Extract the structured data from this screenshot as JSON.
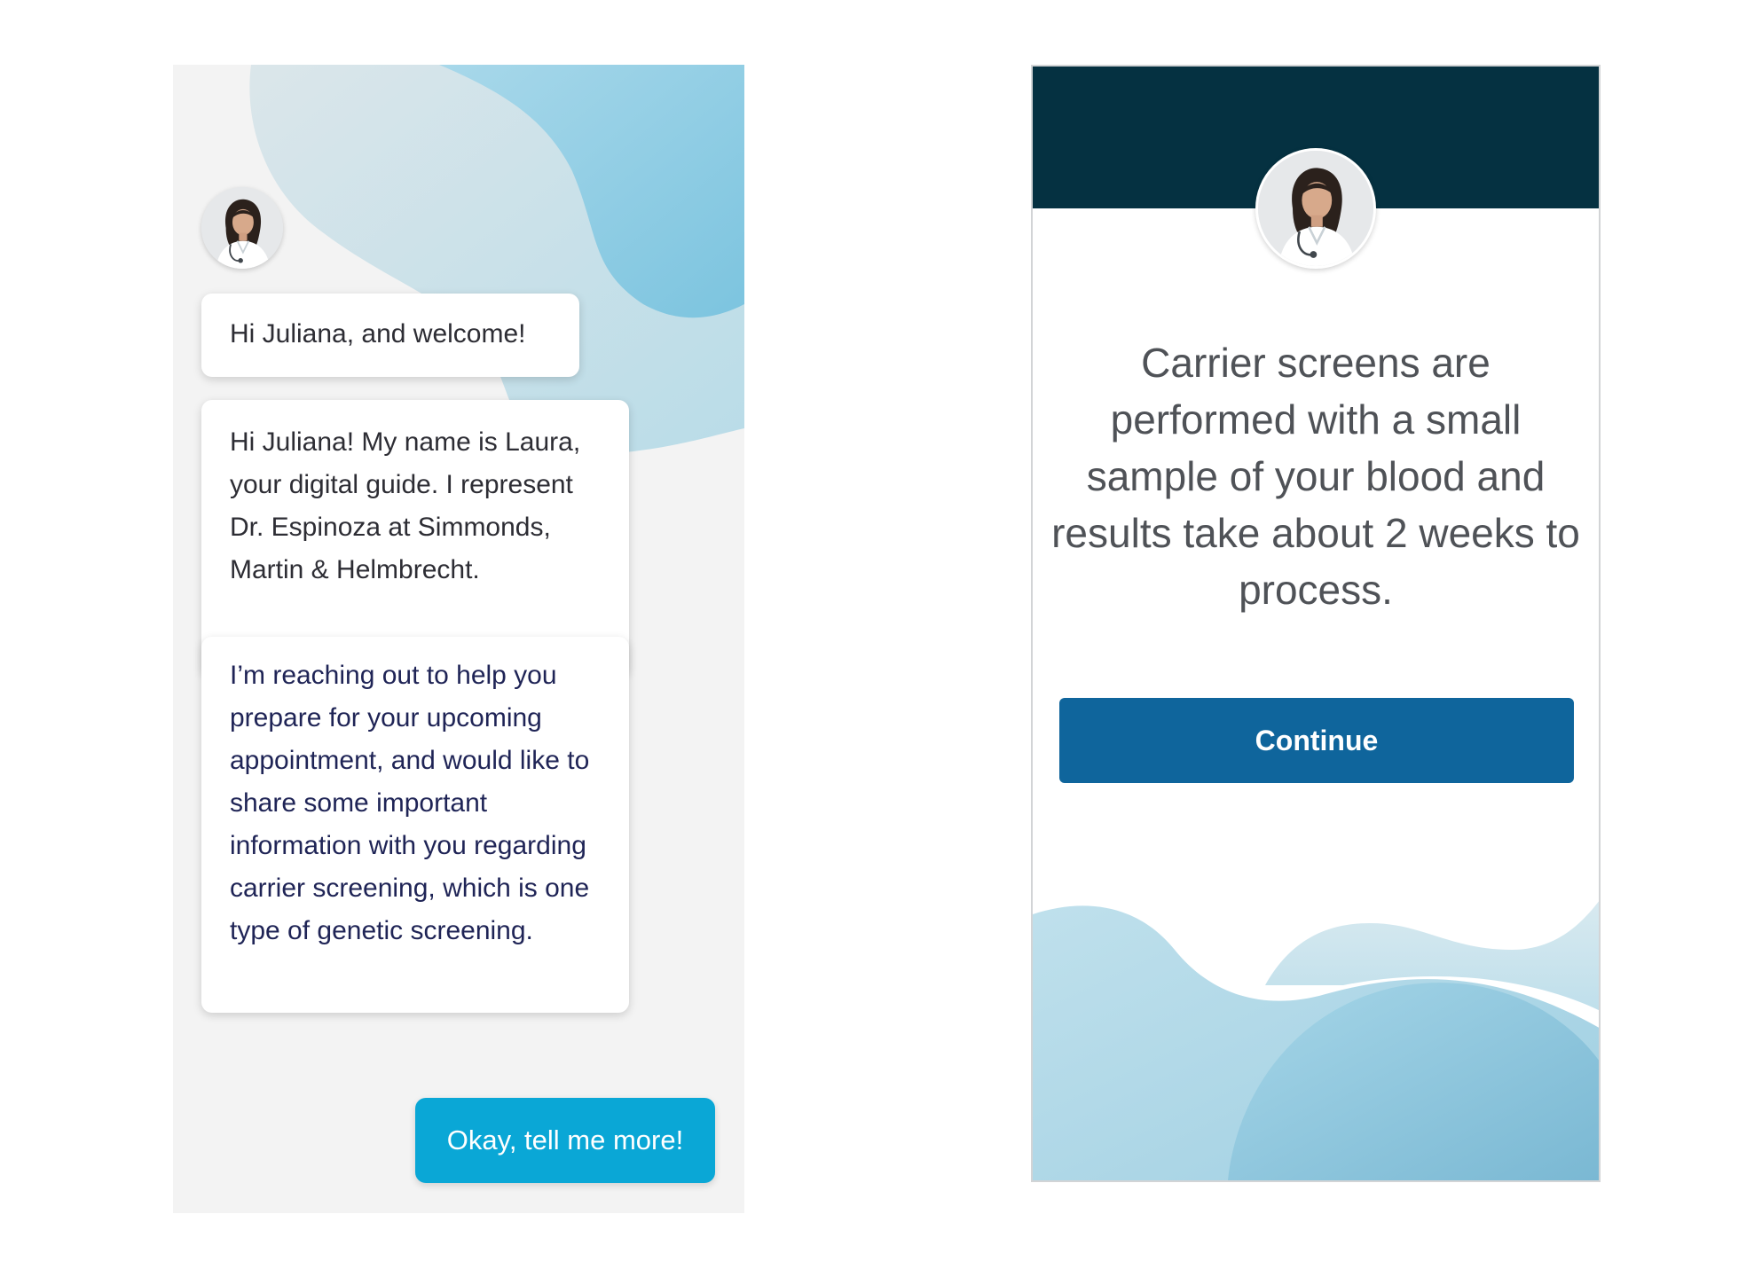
{
  "chat_screen": {
    "messages": [
      {
        "text": "Hi Juliana, and welcome!"
      },
      {
        "text": "Hi Juliana! My name is Laura, your digital guide. I represent Dr. Espinoza at Simmonds, Martin & Helmbrecht."
      },
      {
        "text": "I’m reaching out to help you prepare for your upcoming appointment, and would like to share some important information with you regarding carrier screening, which is one type of genetic screening."
      }
    ],
    "reply_button_label": "Okay, tell me more!",
    "colors": {
      "background": "#f3f3f3",
      "reply_button": "#0aa7d6",
      "message_text_dark": "#2d2d34",
      "message_text_navy": "#1f2456"
    }
  },
  "info_screen": {
    "message": "Carrier screens are performed with a small sample of your blood and results take about 2 weeks to process.",
    "continue_label": "Continue",
    "colors": {
      "header": "#053141",
      "button": "#0f659c",
      "text": "#4f5257"
    }
  },
  "icons": {
    "guide_avatar": "doctor-avatar-icon",
    "decoration": "wave-shapes"
  }
}
